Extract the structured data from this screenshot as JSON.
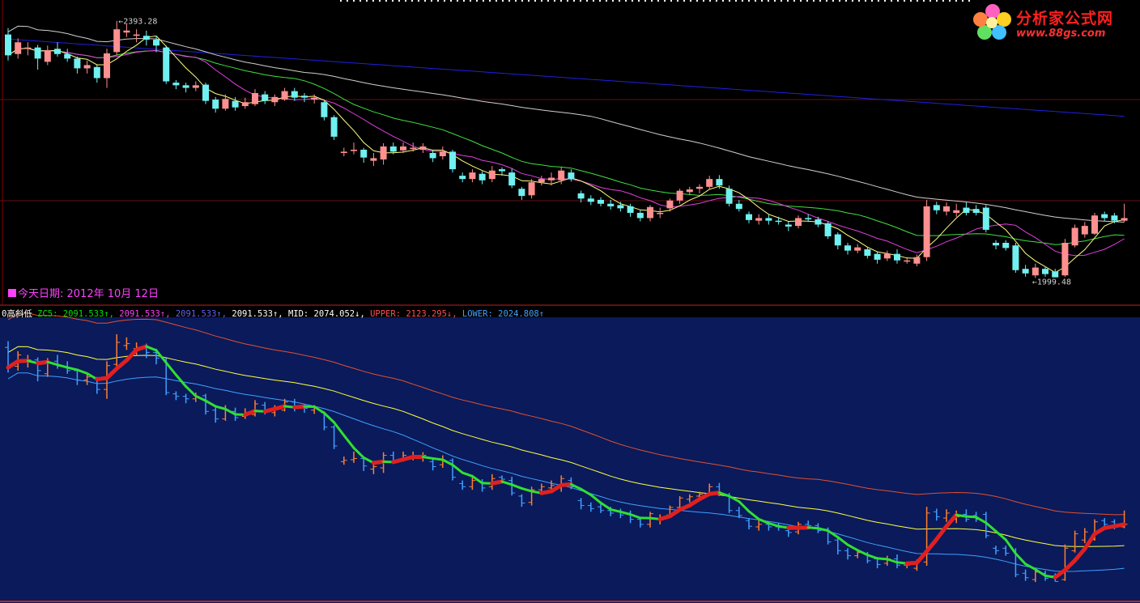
{
  "logo": {
    "name": "分析家公式网",
    "url": "www.88gs.com"
  },
  "top_panel": {
    "date_label": "今天日期: 2012年 10月 12日",
    "high_label": "2393.28",
    "low_label": "1999.48"
  },
  "legend": {
    "indicator": "0高斜低",
    "items": [
      {
        "name": "ZC5",
        "value": "2091.533",
        "arrow": "↑",
        "color": "#00e000"
      },
      {
        "name": "",
        "value": "2091.533",
        "arrow": "↑",
        "color": "#ff40ff"
      },
      {
        "name": "",
        "value": "2091.533",
        "arrow": "↑",
        "color": "#6060ff"
      },
      {
        "name": "",
        "value": "2091.533",
        "arrow": "↑",
        "color": "#ffffff"
      },
      {
        "name": "MID",
        "value": "2074.052",
        "arrow": "↓",
        "color": "#ffffff"
      },
      {
        "name": "UPPER",
        "value": "2123.295",
        "arrow": "↓",
        "color": "#ff5050"
      },
      {
        "name": "LOWER",
        "value": "2024.808",
        "arrow": "↑",
        "color": "#40a0ff"
      }
    ]
  },
  "colors": {
    "up": "#ff9090",
    "down": "#70f0f0",
    "ma5": "#ffff80",
    "ma10": "#e040e0",
    "ma20": "#40e040",
    "ma60": "#d0d0d0",
    "ma250": "#2020e0",
    "bottom_bg": "#0a1a5a",
    "upper": "#e05030",
    "mid": "#ffff40",
    "lower": "#40a0ff",
    "zc5_down": "#30e030",
    "zc5_up": "#e02020"
  },
  "chart_data": [
    {
      "type": "candlestick",
      "y_range": [
        1960,
        2420
      ],
      "candles": [
        [
          2372,
          2340,
          2382,
          2332
        ],
        [
          2342,
          2360,
          2366,
          2335
        ],
        [
          2350,
          2352,
          2360,
          2340
        ],
        [
          2352,
          2335,
          2356,
          2318
        ],
        [
          2330,
          2348,
          2355,
          2325
        ],
        [
          2350,
          2342,
          2360,
          2338
        ],
        [
          2342,
          2335,
          2350,
          2330
        ],
        [
          2335,
          2320,
          2338,
          2312
        ],
        [
          2320,
          2325,
          2332,
          2312
        ],
        [
          2322,
          2305,
          2325,
          2298
        ],
        [
          2305,
          2343,
          2350,
          2290
        ],
        [
          2345,
          2380,
          2393,
          2340
        ],
        [
          2375,
          2378,
          2388,
          2368
        ],
        [
          2370,
          2372,
          2380,
          2360
        ],
        [
          2370,
          2364,
          2378,
          2355
        ],
        [
          2364,
          2355,
          2370,
          2345
        ],
        [
          2352,
          2300,
          2355,
          2296
        ],
        [
          2298,
          2294,
          2302,
          2288
        ],
        [
          2294,
          2290,
          2298,
          2283
        ],
        [
          2290,
          2294,
          2300,
          2285
        ],
        [
          2295,
          2270,
          2298,
          2265
        ],
        [
          2272,
          2258,
          2276,
          2252
        ],
        [
          2258,
          2273,
          2280,
          2255
        ],
        [
          2270,
          2260,
          2276,
          2255
        ],
        [
          2262,
          2268,
          2275,
          2258
        ],
        [
          2265,
          2282,
          2288,
          2262
        ],
        [
          2280,
          2270,
          2285,
          2265
        ],
        [
          2268,
          2276,
          2280,
          2262
        ],
        [
          2272,
          2285,
          2290,
          2270
        ],
        [
          2285,
          2275,
          2290,
          2270
        ],
        [
          2278,
          2275,
          2282,
          2268
        ],
        [
          2272,
          2275,
          2280,
          2266
        ],
        [
          2268,
          2245,
          2270,
          2240
        ],
        [
          2245,
          2215,
          2248,
          2210
        ],
        [
          2190,
          2192,
          2198,
          2185
        ],
        [
          2193,
          2195,
          2206,
          2188
        ],
        [
          2195,
          2183,
          2198,
          2175
        ],
        [
          2178,
          2182,
          2190,
          2170
        ],
        [
          2180,
          2200,
          2205,
          2172
        ],
        [
          2200,
          2192,
          2206,
          2188
        ],
        [
          2194,
          2200,
          2206,
          2190
        ],
        [
          2198,
          2198,
          2206,
          2192
        ],
        [
          2195,
          2200,
          2205,
          2190
        ],
        [
          2190,
          2182,
          2194,
          2176
        ],
        [
          2185,
          2192,
          2200,
          2180
        ],
        [
          2192,
          2165,
          2195,
          2160
        ],
        [
          2155,
          2150,
          2160,
          2145
        ],
        [
          2150,
          2160,
          2165,
          2145
        ],
        [
          2158,
          2148,
          2162,
          2142
        ],
        [
          2150,
          2163,
          2170,
          2145
        ],
        [
          2165,
          2162,
          2168,
          2155
        ],
        [
          2160,
          2140,
          2166,
          2136
        ],
        [
          2135,
          2124,
          2138,
          2118
        ],
        [
          2125,
          2145,
          2150,
          2120
        ],
        [
          2145,
          2150,
          2155,
          2140
        ],
        [
          2148,
          2152,
          2160,
          2140
        ],
        [
          2148,
          2163,
          2168,
          2142
        ],
        [
          2160,
          2150,
          2165,
          2146
        ],
        [
          2128,
          2120,
          2132,
          2114
        ],
        [
          2120,
          2115,
          2125,
          2110
        ],
        [
          2118,
          2112,
          2122,
          2108
        ],
        [
          2112,
          2108,
          2118,
          2103
        ],
        [
          2110,
          2105,
          2115,
          2100
        ],
        [
          2108,
          2098,
          2112,
          2092
        ],
        [
          2098,
          2090,
          2102,
          2085
        ],
        [
          2090,
          2107,
          2110,
          2085
        ],
        [
          2098,
          2098,
          2106,
          2090
        ],
        [
          2105,
          2117,
          2120,
          2100
        ],
        [
          2117,
          2132,
          2135,
          2112
        ],
        [
          2130,
          2134,
          2138,
          2125
        ],
        [
          2135,
          2138,
          2142,
          2128
        ],
        [
          2138,
          2150,
          2155,
          2135
        ],
        [
          2150,
          2140,
          2156,
          2135
        ],
        [
          2135,
          2112,
          2140,
          2108
        ],
        [
          2112,
          2104,
          2118,
          2100
        ],
        [
          2096,
          2087,
          2100,
          2082
        ],
        [
          2086,
          2090,
          2096,
          2080
        ],
        [
          2090,
          2086,
          2095,
          2080
        ],
        [
          2086,
          2085,
          2092,
          2080
        ],
        [
          2080,
          2077,
          2085,
          2070
        ],
        [
          2078,
          2090,
          2094,
          2074
        ],
        [
          2090,
          2088,
          2096,
          2084
        ],
        [
          2088,
          2080,
          2092,
          2076
        ],
        [
          2082,
          2062,
          2085,
          2058
        ],
        [
          2065,
          2048,
          2068,
          2042
        ],
        [
          2048,
          2040,
          2052,
          2034
        ],
        [
          2040,
          2045,
          2050,
          2036
        ],
        [
          2042,
          2032,
          2046,
          2028
        ],
        [
          2035,
          2026,
          2038,
          2020
        ],
        [
          2028,
          2035,
          2040,
          2024
        ],
        [
          2035,
          2025,
          2042,
          2020
        ],
        [
          2025,
          2025,
          2030,
          2020
        ],
        [
          2020,
          2030,
          2034,
          2016
        ],
        [
          2030,
          2108,
          2118,
          2024
        ],
        [
          2110,
          2102,
          2115,
          2096
        ],
        [
          2100,
          2108,
          2114,
          2094
        ],
        [
          2098,
          2102,
          2112,
          2092
        ],
        [
          2106,
          2098,
          2114,
          2094
        ],
        [
          2104,
          2098,
          2110,
          2094
        ],
        [
          2106,
          2072,
          2110,
          2068
        ],
        [
          2052,
          2048,
          2056,
          2042
        ],
        [
          2052,
          2044,
          2056,
          2040
        ],
        [
          2048,
          2010,
          2052,
          2006
        ],
        [
          2012,
          2005,
          2018,
          2000
        ],
        [
          2002,
          2014,
          2020,
          1998
        ],
        [
          2012,
          2004,
          2016,
          2000
        ],
        [
          2008,
          1999,
          2012,
          1999
        ],
        [
          2002,
          2052,
          2058,
          2000
        ],
        [
          2048,
          2075,
          2080,
          2045
        ],
        [
          2065,
          2078,
          2084,
          2060
        ],
        [
          2066,
          2094,
          2098,
          2064
        ],
        [
          2096,
          2090,
          2100,
          2085
        ],
        [
          2094,
          2086,
          2098,
          2082
        ],
        [
          2086,
          2090,
          2112,
          2084
        ]
      ]
    },
    {
      "type": "line",
      "indicator": "0高斜低",
      "series_names": [
        "ZC5",
        "MID",
        "UPPER",
        "LOWER"
      ],
      "y_range": [
        1975,
        2420
      ]
    }
  ]
}
